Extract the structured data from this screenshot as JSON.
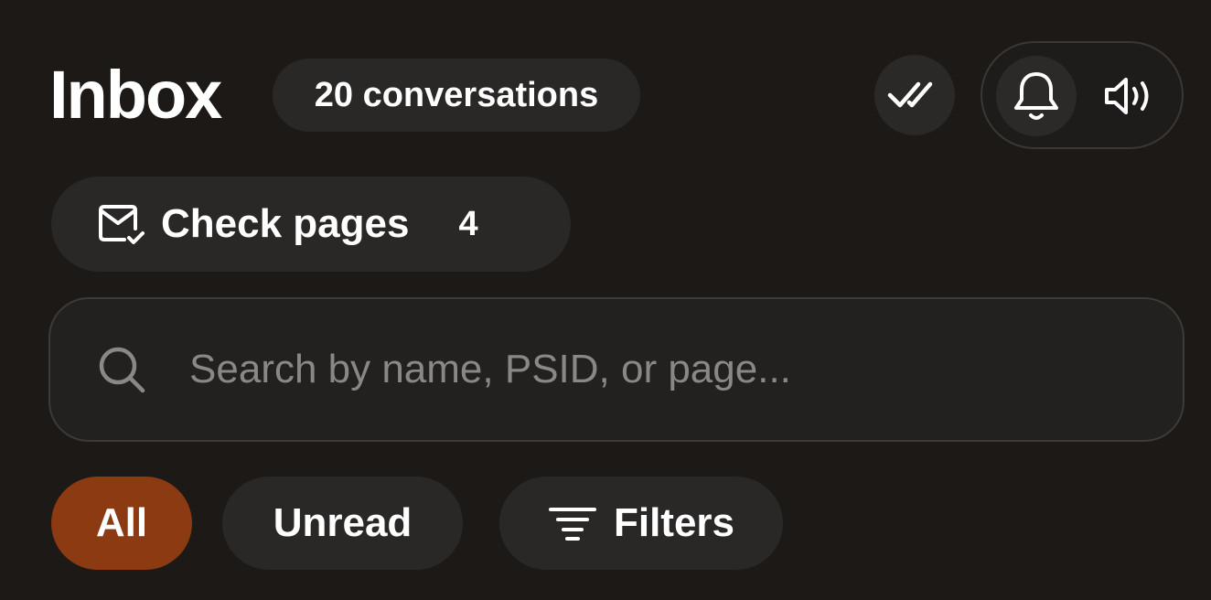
{
  "header": {
    "title": "Inbox",
    "conversation_count": "20 conversations"
  },
  "actions": {
    "mark_all_read_icon": "double-check-icon",
    "notifications_icon": "bell-icon",
    "sound_icon": "speaker-icon"
  },
  "check_pages": {
    "label": "Check pages",
    "count": "4",
    "icon": "mail-check-icon"
  },
  "search": {
    "placeholder": "Search by name, PSID, or page...",
    "value": "",
    "icon": "search-icon"
  },
  "filter_chips": {
    "all": "All",
    "unread": "Unread",
    "filters": "Filters",
    "active": "All",
    "filters_icon": "filter-lines-icon"
  },
  "colors": {
    "background": "#1c1917",
    "chip": "#292826",
    "active_chip": "#8b3a12",
    "text": "#ffffff",
    "placeholder": "#8a8784"
  }
}
